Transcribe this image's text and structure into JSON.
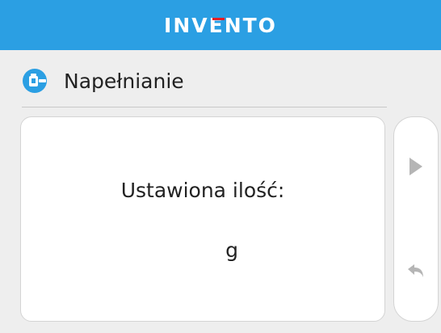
{
  "brand": {
    "name": "INVENTO",
    "accent": "#e41e26",
    "bar_color": "#2b9fe3"
  },
  "screen": {
    "title": "Napełnianie",
    "icon": "fill-dispenser-icon"
  },
  "main": {
    "label": "Ustawiona ilość:",
    "value": "",
    "unit": "g"
  },
  "nav": {
    "next_icon": "play-arrow-icon",
    "back_icon": "return-arrow-icon"
  }
}
